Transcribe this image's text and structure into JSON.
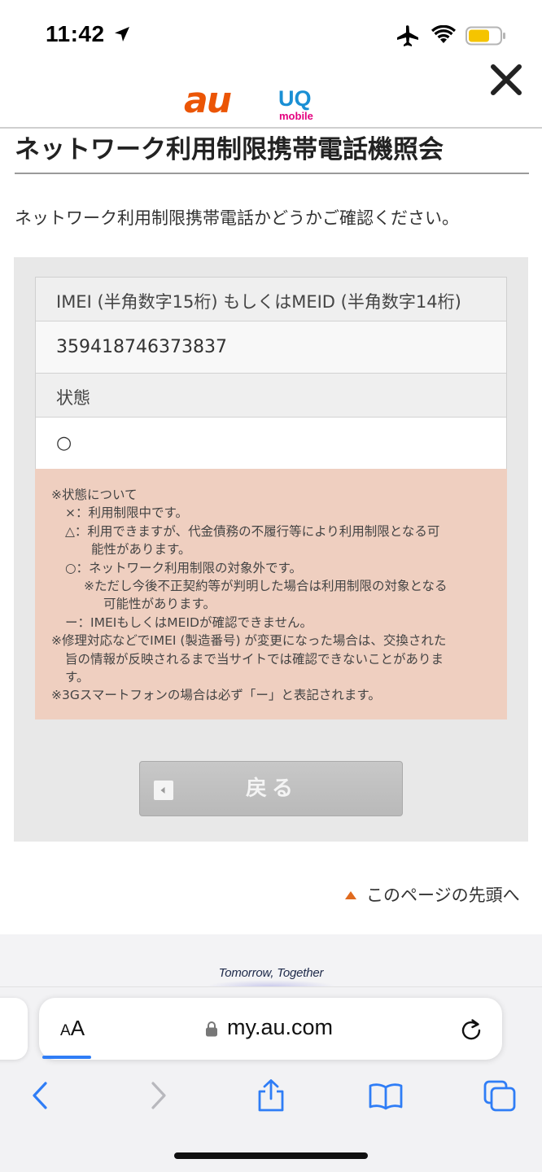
{
  "status_bar": {
    "time": "11:42"
  },
  "header": {
    "logo_au_text": "au",
    "logo_uq_text": "UQ",
    "logo_uq_sub": "mobile",
    "title": "ネットワーク利用制限携帯電話機照会"
  },
  "intro_text": "ネットワーク利用制限携帯電話かどうかご確認ください。",
  "result_table": {
    "imei_label": "IMEI (半角数字15桁) もしくはMEID (半角数字14桁)",
    "imei_value": "359418746373837",
    "status_label": "状態",
    "status_value": "○"
  },
  "notes": {
    "heading": "※状態について",
    "lines": [
      "×：利用制限中です。",
      "△：利用できますが、代金債務の不履行等により利用制限となる可",
      "能性があります。",
      "○：ネットワーク利用制限の対象外です。",
      "※ただし今後不正契約等が判明した場合は利用制限の対象となる",
      "可能性があります。",
      "ー：IMEIもしくはMEIDが確認できません。",
      "※修理対応などでIMEI (製造番号) が変更になった場合は、交換された",
      "旨の情報が反映されるまで当サイトでは確認できないことがありま",
      "す。",
      "※3Gスマートフォンの場合は必ず「ー」と表記されます。"
    ]
  },
  "back_button_label": "戻る",
  "page_top_link": "このページの先頭へ",
  "footer": {
    "tagline": "Tomorrow, Together"
  },
  "browser": {
    "aa_label_small": "A",
    "aa_label_big": "A",
    "url": "my.au.com",
    "accent_color": "#2f7df6"
  },
  "colors": {
    "au_brand": "#eb5505",
    "uq_brand": "#1a8fd4",
    "uq_mobile": "#e4007f",
    "note_bg": "#efcfc0"
  }
}
